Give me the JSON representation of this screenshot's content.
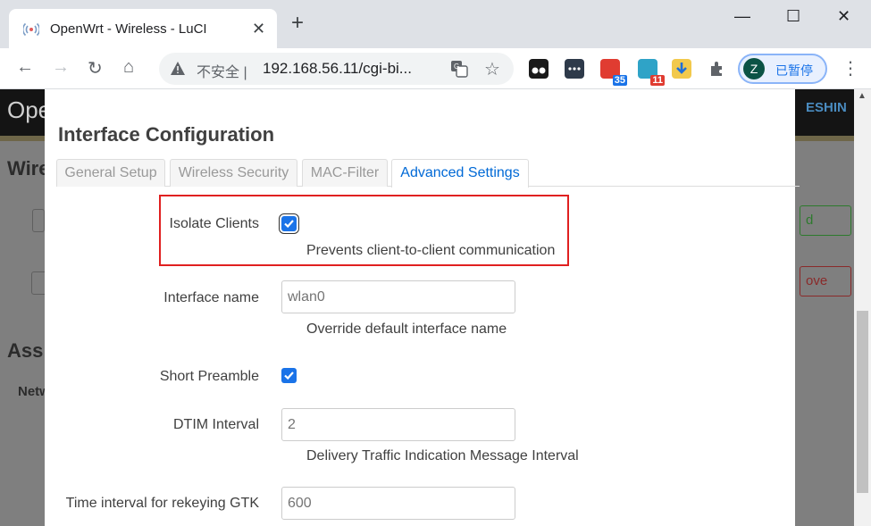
{
  "browser": {
    "tab_title": "OpenWrt - Wireless - LuCI",
    "tab_close": "✕",
    "new_tab": "+",
    "window_controls": [
      "—",
      "☐",
      "✕"
    ],
    "nav": {
      "back": "←",
      "forward": "→",
      "reload": "↻",
      "home": "⌂"
    },
    "omnibox": {
      "security_label": "不安全",
      "separator": "|",
      "url": "192.168.56.11/cgi-bi...",
      "bookmark_icon": "☆"
    },
    "extensions": [
      {
        "name": "tampermonkey-icon",
        "color": "#1a1a1a"
      },
      {
        "name": "chat-ext-icon",
        "color": "#2e3a4a"
      },
      {
        "name": "red-ext-icon",
        "color": "#e03c31",
        "badge": "35",
        "badge_color": "#1a73e8"
      },
      {
        "name": "multi-ext-icon",
        "color": "#2fa3c7",
        "badge": "11",
        "badge_color": "#e03c31"
      },
      {
        "name": "download-ext-icon",
        "color": "#f2c94c"
      },
      {
        "name": "puzzle-icon",
        "color": "#5f6368"
      }
    ],
    "profile": {
      "initial": "Z",
      "label": "已暂停"
    },
    "menu": "⋮"
  },
  "background": {
    "logo": "Ope",
    "right_label": "ESHIN",
    "heading_1": "Wire",
    "heading_2": "Ass",
    "table_header": "Netw",
    "button_add": "d",
    "button_remove": "ove"
  },
  "modal": {
    "title": "Interface Configuration",
    "tabs": [
      {
        "label": "General Setup",
        "active": false
      },
      {
        "label": "Wireless Security",
        "active": false
      },
      {
        "label": "MAC-Filter",
        "active": false
      },
      {
        "label": "Advanced Settings",
        "active": true
      }
    ],
    "fields": {
      "isolate_clients": {
        "label": "Isolate Clients",
        "checked": true,
        "description": "Prevents client-to-client communication"
      },
      "interface_name": {
        "label": "Interface name",
        "placeholder": "wlan0",
        "description": "Override default interface name"
      },
      "short_preamble": {
        "label": "Short Preamble",
        "checked": true
      },
      "dtim_interval": {
        "label": "DTIM Interval",
        "placeholder": "2",
        "description": "Delivery Traffic Indication Message Interval"
      },
      "rekey_gtk": {
        "label": "Time interval for rekeying GTK",
        "placeholder": "600"
      }
    }
  },
  "colors": {
    "accent": "#1a73e8",
    "tab_active": "#0069d6",
    "highlight": "#e02020"
  }
}
